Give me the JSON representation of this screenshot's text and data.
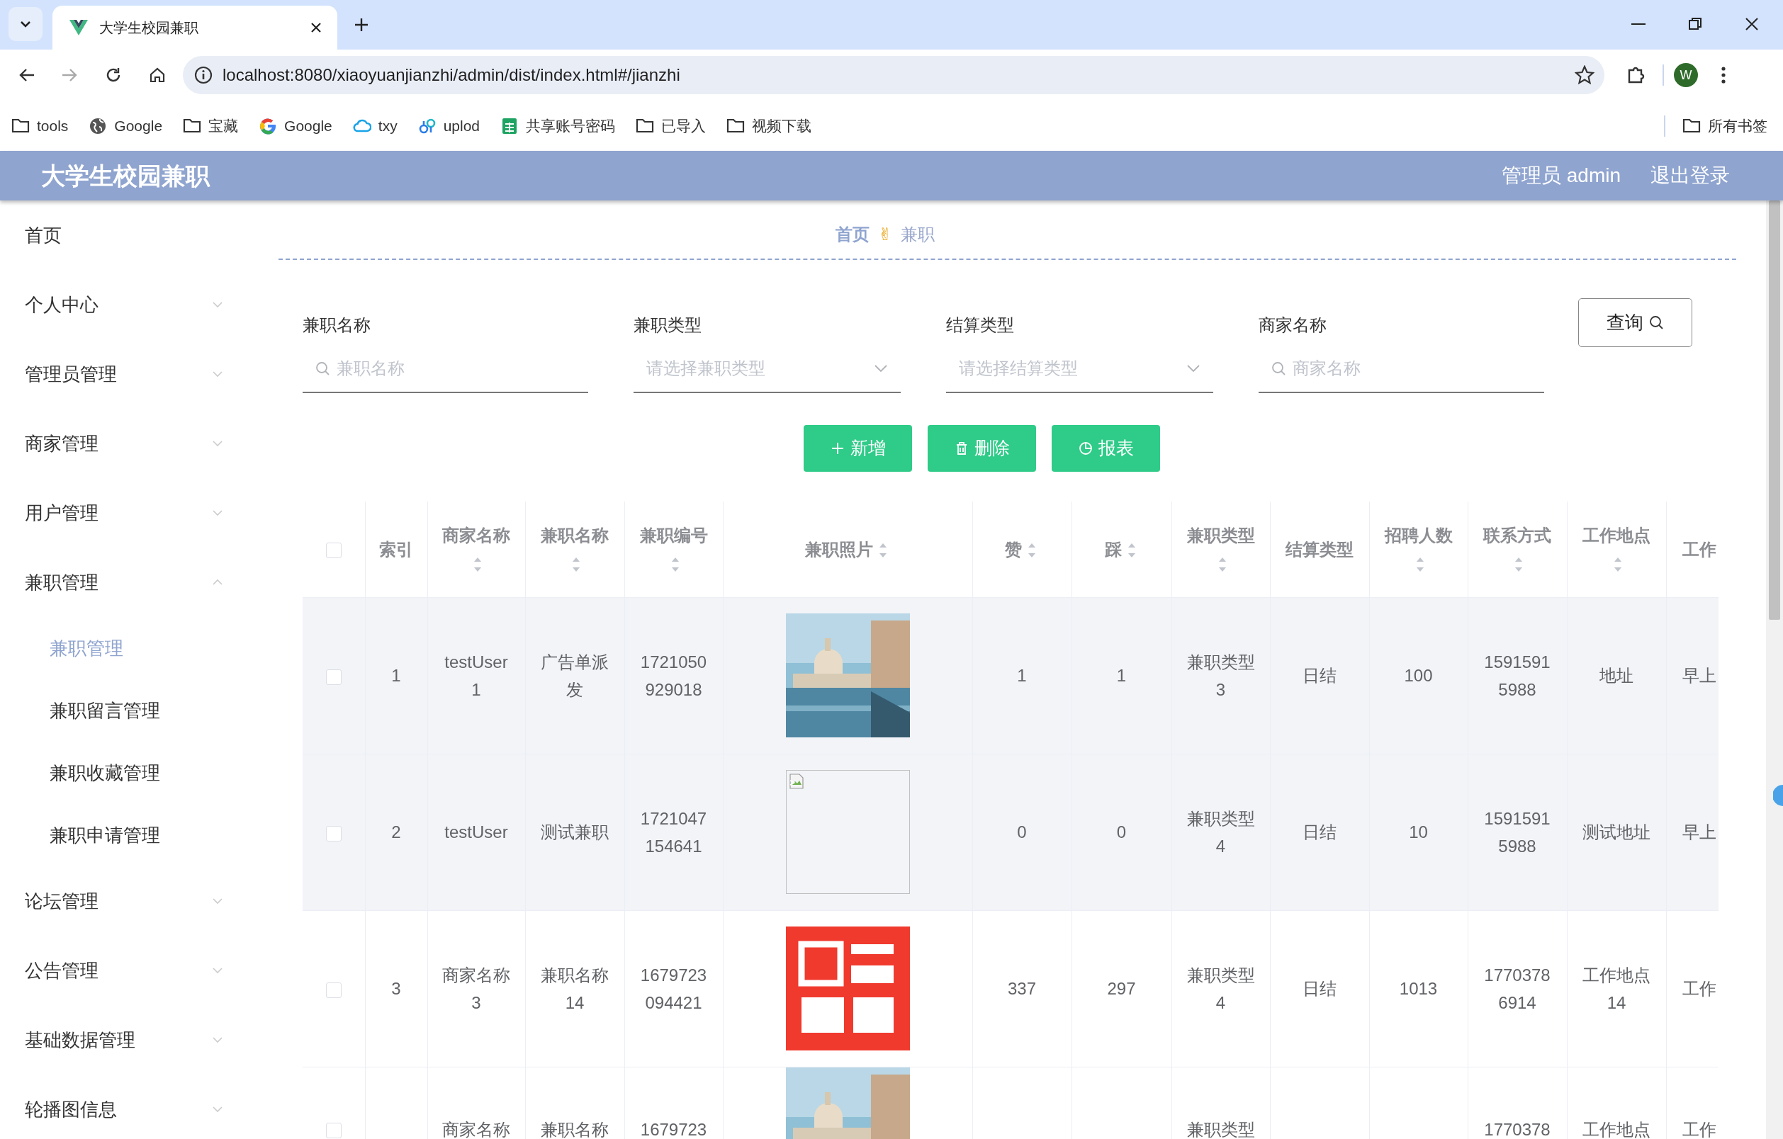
{
  "browser": {
    "tab_title": "大学生校园兼职",
    "url": "localhost:8080/xiaoyuanjianzhi/admin/dist/index.html#/jianzhi",
    "profile_initial": "W",
    "all_bookmarks": "所有书签",
    "bookmarks": [
      {
        "label": "tools",
        "kind": "folder"
      },
      {
        "label": "Google",
        "kind": "globe"
      },
      {
        "label": "宝藏",
        "kind": "folder"
      },
      {
        "label": "Google",
        "kind": "google"
      },
      {
        "label": "txy",
        "kind": "cloud"
      },
      {
        "label": "uplod",
        "kind": "link"
      },
      {
        "label": "共享账号密码",
        "kind": "sheet"
      },
      {
        "label": "已导入",
        "kind": "folder"
      },
      {
        "label": "视频下载",
        "kind": "folder"
      }
    ]
  },
  "app": {
    "title": "大学生校园兼职",
    "user": "管理员 admin",
    "logout": "退出登录"
  },
  "sidebar": {
    "items": [
      {
        "label": "首页",
        "kind": "link",
        "selected": false
      },
      {
        "label": "个人中心",
        "kind": "group",
        "expanded": false,
        "selected": false
      },
      {
        "label": "管理员管理",
        "kind": "group",
        "expanded": false,
        "selected": false
      },
      {
        "label": "商家管理",
        "kind": "group",
        "expanded": false,
        "selected": false
      },
      {
        "label": "用户管理",
        "kind": "group",
        "expanded": false,
        "selected": false
      },
      {
        "label": "兼职管理",
        "kind": "group",
        "expanded": true,
        "selected": false,
        "children": [
          {
            "label": "兼职管理",
            "selected": true
          },
          {
            "label": "兼职留言管理",
            "selected": false
          },
          {
            "label": "兼职收藏管理",
            "selected": false
          },
          {
            "label": "兼职申请管理",
            "selected": false
          }
        ]
      },
      {
        "label": "论坛管理",
        "kind": "group",
        "expanded": false,
        "selected": false
      },
      {
        "label": "公告管理",
        "kind": "group",
        "expanded": false,
        "selected": false
      },
      {
        "label": "基础数据管理",
        "kind": "group",
        "expanded": false,
        "selected": false
      },
      {
        "label": "轮播图信息",
        "kind": "group",
        "expanded": false,
        "selected": false
      }
    ]
  },
  "breadcrumb": {
    "items": [
      "首页",
      "兼职"
    ],
    "separator": "✌"
  },
  "filters": [
    {
      "label": "兼职名称",
      "kind": "text",
      "placeholder": "兼职名称"
    },
    {
      "label": "兼职类型",
      "kind": "select",
      "placeholder": "请选择兼职类型"
    },
    {
      "label": "结算类型",
      "kind": "select",
      "placeholder": "请选择结算类型"
    },
    {
      "label": "商家名称",
      "kind": "text",
      "placeholder": "商家名称"
    }
  ],
  "query_button": "查询",
  "actions": [
    {
      "label": "新增"
    },
    {
      "label": "删除"
    },
    {
      "label": "报表"
    }
  ],
  "table": {
    "select_all_checked": false,
    "columns": [
      {
        "label": "索引",
        "sortable": false
      },
      {
        "label": "商家名称",
        "sortable": true
      },
      {
        "label": "兼职名称",
        "sortable": true
      },
      {
        "label": "兼职编号",
        "sortable": true
      },
      {
        "label": "兼职照片",
        "sortable": true
      },
      {
        "label": "赞",
        "sortable": true
      },
      {
        "label": "踩",
        "sortable": true
      },
      {
        "label": "兼职类型",
        "sortable": true
      },
      {
        "label": "结算类型",
        "sortable": false
      },
      {
        "label": "招聘人数",
        "sortable": true
      },
      {
        "label": "联系方式",
        "sortable": true
      },
      {
        "label": "工作地点",
        "sortable": true
      },
      {
        "label": "工作",
        "sortable": false
      }
    ],
    "rows": [
      {
        "checked": false,
        "highlighted": true,
        "cells": [
          "1",
          "testUser1",
          "广告单派发",
          "1721050929018",
          {
            "kind": "picture"
          },
          "1",
          "1",
          "兼职类型3",
          "日结",
          "100",
          "15915915988",
          "地址",
          "早上"
        ]
      },
      {
        "checked": false,
        "highlighted": true,
        "cells": [
          "2",
          "testUser",
          "测试兼职",
          "1721047154641",
          {
            "kind": "broken-image"
          },
          "0",
          "0",
          "兼职类型4",
          "日结",
          "10",
          "15915915988",
          "测试地址",
          "早上"
        ]
      },
      {
        "checked": false,
        "highlighted": false,
        "cells": [
          "3",
          "商家名称3",
          "兼职名称14",
          "1679723094421",
          {
            "kind": "picture"
          },
          "337",
          "297",
          "兼职类型4",
          "日结",
          "1013",
          "17703786914",
          "工作地点14",
          "工作"
        ]
      },
      {
        "checked": false,
        "highlighted": false,
        "cells": [
          null,
          "商家名称",
          "兼职名称",
          "1679723",
          {
            "kind": "picture"
          },
          null,
          null,
          "兼职类型",
          null,
          null,
          "1770378",
          "工作地点",
          "工作"
        ]
      }
    ]
  }
}
